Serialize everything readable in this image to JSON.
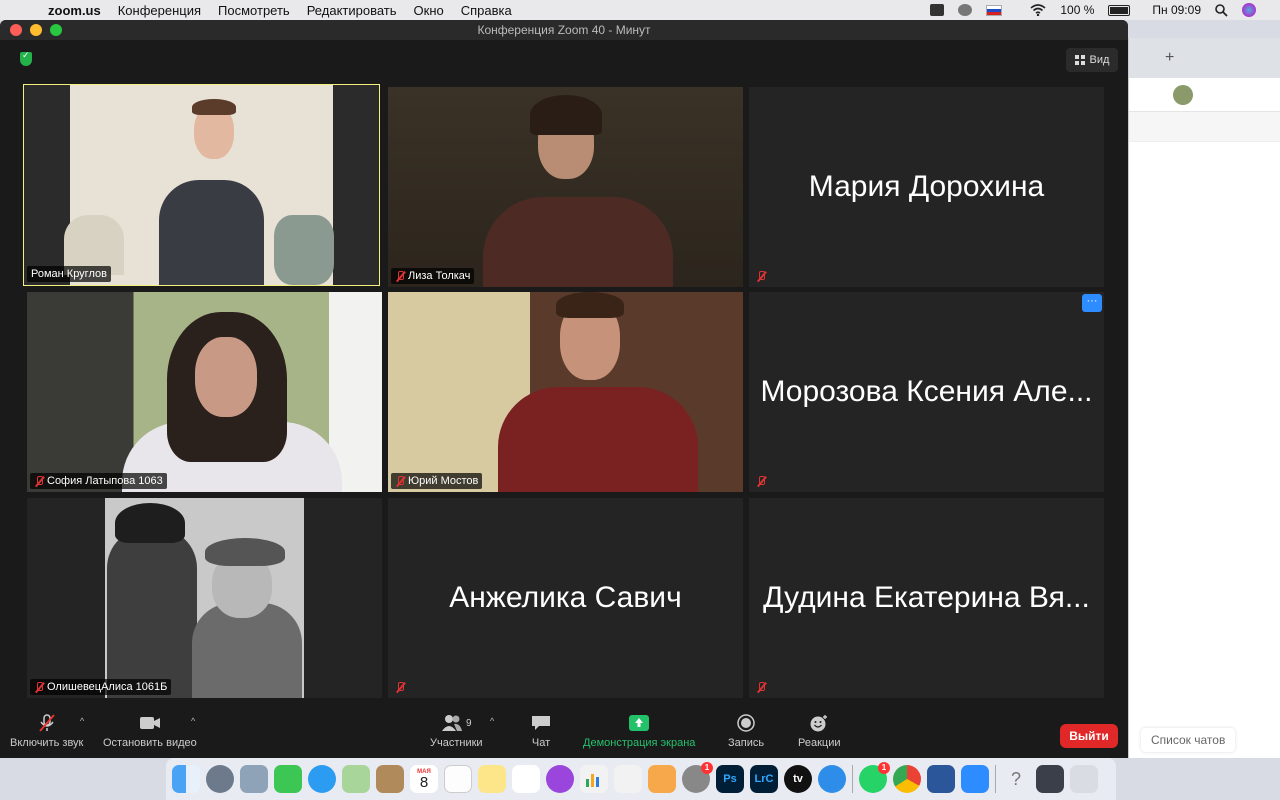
{
  "menubar": {
    "app_name": "zoom.us",
    "items": [
      "Конференция",
      "Посмотреть",
      "Редактировать",
      "Окно",
      "Справка"
    ],
    "battery": "100 %",
    "clock": "Пн 09:09"
  },
  "window": {
    "title": "Конференция Zoom   40 - Минут"
  },
  "view_button": {
    "label": "Вид"
  },
  "participants": [
    {
      "name": "Роман Круглов",
      "video": true,
      "muted": false,
      "active_speaker": true
    },
    {
      "name": "Лиза Толкач",
      "video": true,
      "muted": true
    },
    {
      "name": "Мария Дорохина",
      "video": false,
      "muted": true
    },
    {
      "name": "София Латыпова 1063",
      "video": true,
      "muted": true
    },
    {
      "name": "Юрий Мостов",
      "video": true,
      "muted": true
    },
    {
      "name": "Морозова Ксения Але...",
      "video": false,
      "muted": true,
      "more_menu": true,
      "more_label": "···"
    },
    {
      "name": "ОлишевецАлиса 1061Б",
      "video": true,
      "muted": true
    },
    {
      "name": "Анжелика Савич",
      "video": false,
      "muted": true
    },
    {
      "name": "Дудина Екатерина Вя...",
      "video": false,
      "muted": true
    }
  ],
  "toolbar": {
    "mute_label": "Включить звук",
    "video_label": "Остановить видео",
    "participants_label": "Участники",
    "participants_count": "9",
    "chat_label": "Чат",
    "share_label": "Демонстрация экрана",
    "record_label": "Запись",
    "reactions_label": "Реакции",
    "leave_label": "Выйти"
  },
  "browser": {
    "chat_list_label": "Список чатов"
  },
  "dock": {
    "calendar_month": "МАЯ",
    "calendar_day": "8",
    "ps_label": "Ps",
    "lrc_label": "LrC",
    "tv_label": "tv",
    "whatsapp_badge": "1",
    "prefs_badge": "1",
    "help_label": "?"
  },
  "colors": {
    "active_speaker_border": "#f4f07e",
    "share_green": "#24c16b",
    "leave_red": "#e02828",
    "more_blue": "#2d8cff"
  }
}
